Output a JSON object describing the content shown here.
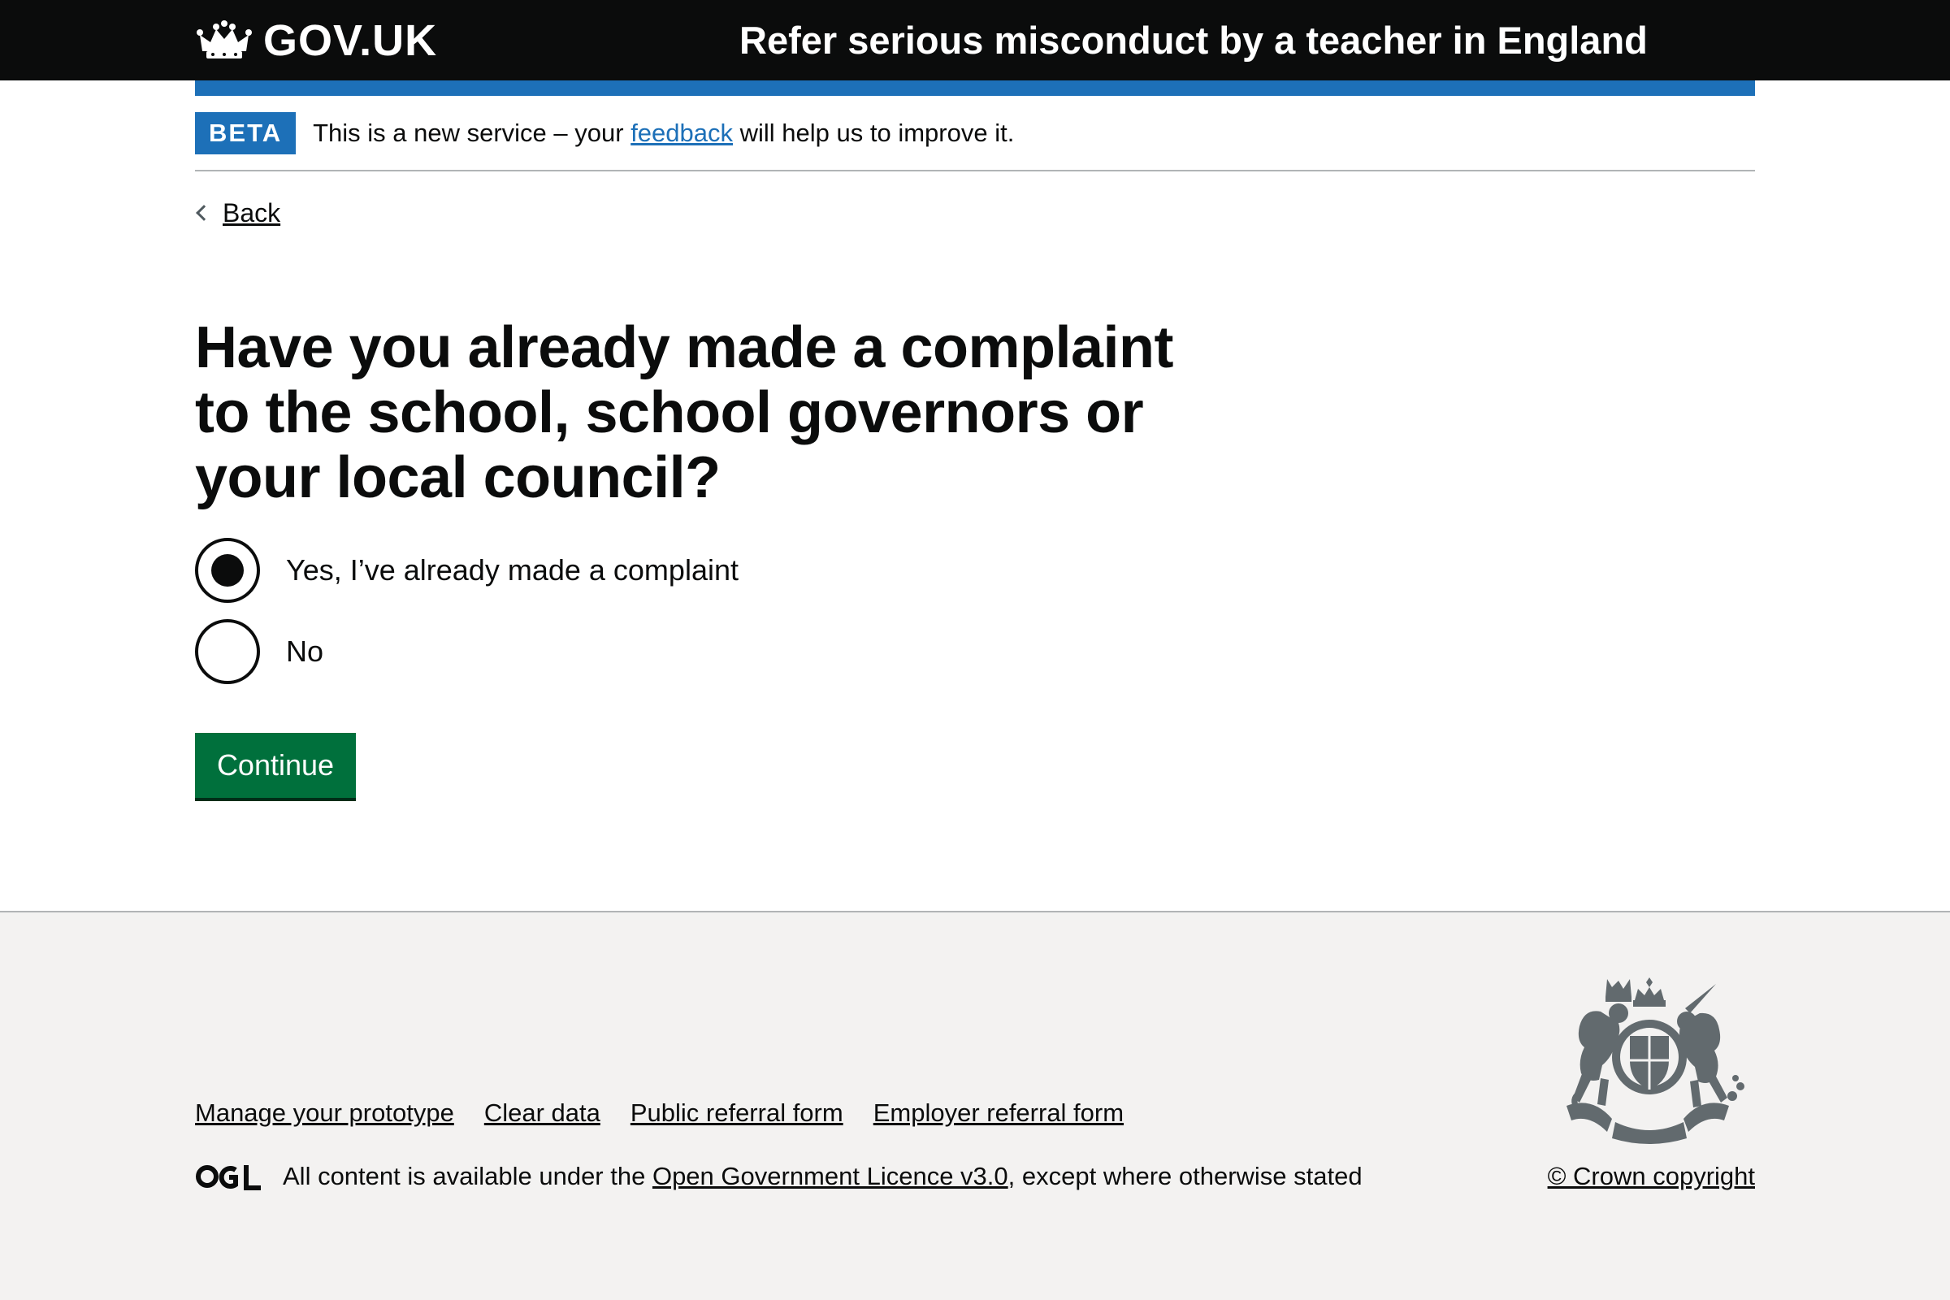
{
  "header": {
    "logo_text": "GOV.UK",
    "service_name": "Refer serious misconduct by a teacher in England"
  },
  "phase_banner": {
    "tag": "BETA",
    "text_before": "This is a new service – your ",
    "link": "feedback",
    "text_after": " will help us to improve it."
  },
  "back_link": "Back",
  "question": "Have you already made a complaint to the school, school governors or your local council?",
  "options": [
    {
      "label": "Yes, I’ve already made a complaint",
      "checked": true
    },
    {
      "label": "No",
      "checked": false
    }
  ],
  "continue_button": "Continue",
  "footer": {
    "links": [
      "Manage your prototype",
      "Clear data",
      "Public referral form",
      "Employer referral form"
    ],
    "licence_before": "All content is available under the ",
    "licence_link": "Open Government Licence v3.0",
    "licence_after": ", except where otherwise stated",
    "copyright": "© Crown copyright"
  },
  "icons": {
    "logo": "crown-icon",
    "back": "chevron-left-icon",
    "licence": "ogl-logo-icon",
    "crest": "royal-coat-of-arms-icon"
  },
  "colors": {
    "header_bg": "#0b0c0c",
    "brand_blue": "#1d70b8",
    "button_green": "#00703c",
    "footer_bg": "#f3f2f1"
  }
}
